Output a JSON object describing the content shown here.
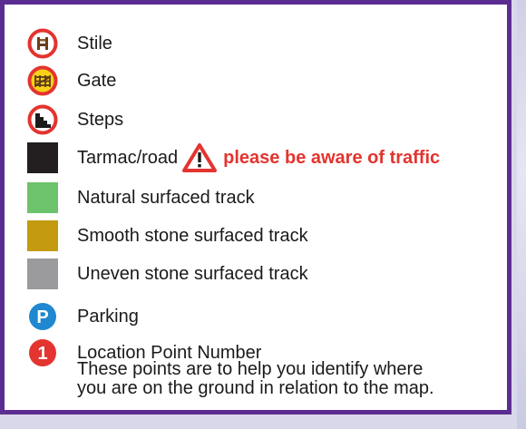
{
  "legend": {
    "items": [
      {
        "label": "Stile",
        "icon": "stile-icon"
      },
      {
        "label": "Gate",
        "icon": "gate-icon"
      },
      {
        "label": "Steps",
        "icon": "steps-icon"
      },
      {
        "label": "Tarmac/road",
        "icon": "tarmac-swatch",
        "warning": "please be aware of traffic",
        "warning_icon": "warning-triangle-icon"
      },
      {
        "label": "Natural surfaced track",
        "icon": "natural-track-swatch"
      },
      {
        "label": "Smooth stone surfaced track",
        "icon": "smooth-stone-swatch"
      },
      {
        "label": "Uneven stone surfaced track",
        "icon": "uneven-stone-swatch"
      },
      {
        "label": "Parking",
        "icon": "parking-icon",
        "glyph": "P"
      },
      {
        "label": "Location Point Number",
        "icon": "location-point-icon",
        "glyph": "1",
        "description_lines": [
          "These points are to help you identify where",
          "you are on the ground in relation to the map."
        ]
      }
    ]
  },
  "colors": {
    "border": "#5b2d91",
    "symbol_red": "#e3342f",
    "tarmac": "#231f20",
    "natural_track": "#6cc36b",
    "smooth_stone": "#c49a10",
    "uneven_stone": "#9b9b9e",
    "parking_blue": "#1f88d0",
    "warning_text": "#e3342f"
  }
}
